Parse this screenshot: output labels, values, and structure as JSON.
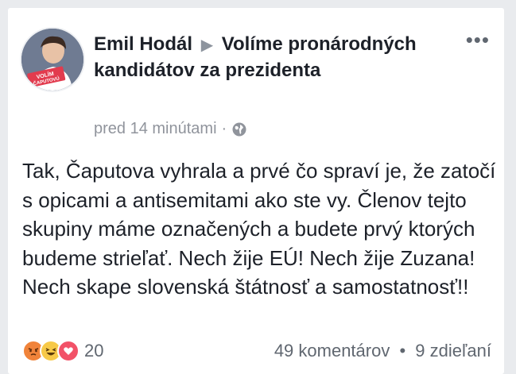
{
  "post": {
    "author": "Emil Hodál",
    "group": "Volíme pronárodných kandidátov za prezidenta",
    "avatar_caption": "VOLÍM ČAPUTOVÚ",
    "timestamp": "pred 14 minútami",
    "meta_separator": "·",
    "privacy_icon": "globe-icon",
    "more_label": "•••",
    "text": "Tak, Čaputova vyhrala a prvé čo spraví je, že zatočí s opicami a antisemitami ako ste vy. Členov tejto skupiny máme označených a budete prvý ktorých budeme strieľať. Nech žije EÚ! Nech žije Zuzana! Nech skape slovenská štátnosť a samostatnosť!!"
  },
  "reactions": {
    "icons": [
      "angry-icon",
      "haha-icon",
      "love-icon"
    ],
    "count": "20"
  },
  "stats": {
    "comments": "49 komentárov",
    "separator": "•",
    "shares": "9 zdieľaní"
  },
  "colors": {
    "background": "#e9ebee",
    "text": "#1d2129",
    "meta": "#90949c",
    "angry": "#f0833a",
    "haha": "#f7c948",
    "love": "#f25268"
  }
}
